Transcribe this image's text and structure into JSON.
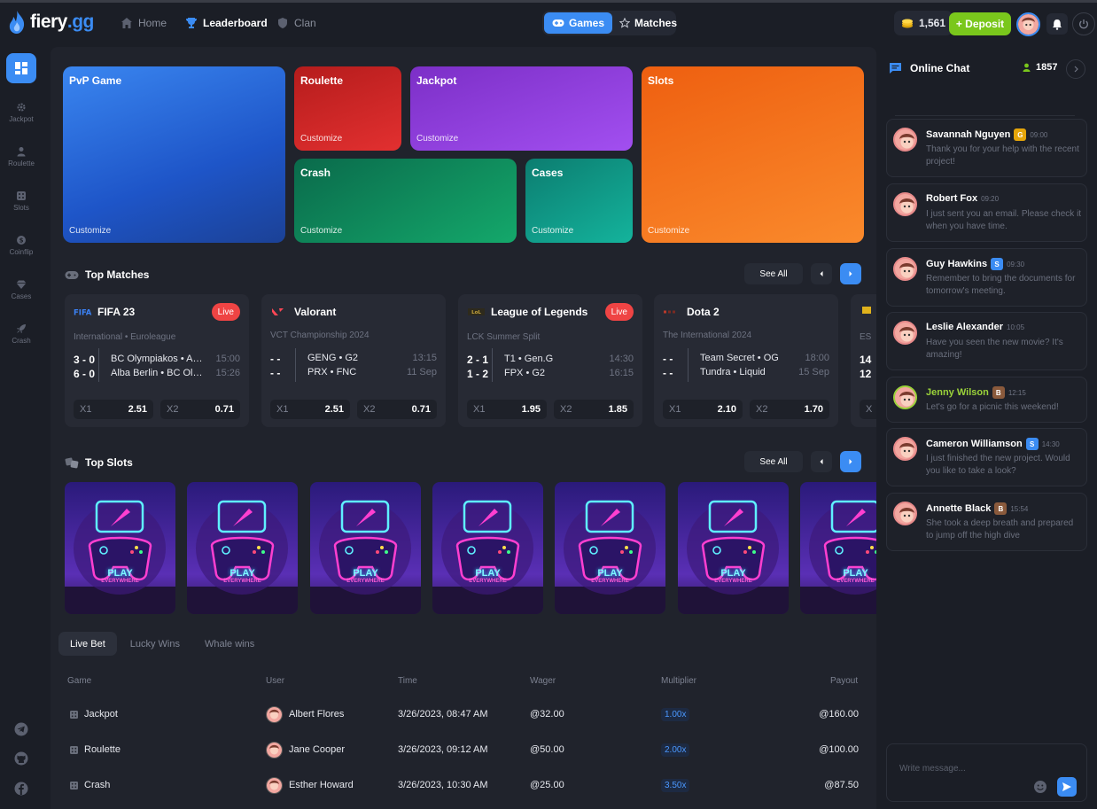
{
  "brand": {
    "name_main": "fiery",
    "name_suffix": ".gg"
  },
  "nav": [
    {
      "label": "Home",
      "icon": "home-icon"
    },
    {
      "label": "Leaderboard",
      "icon": "trophy-icon"
    },
    {
      "label": "Clan",
      "icon": "shield-icon"
    }
  ],
  "mode_switch": {
    "games": "Games",
    "matches": "Matches"
  },
  "header": {
    "balance": "1,561",
    "deposit": "+ Deposit"
  },
  "sidebar": [
    {
      "label": "Jackpot",
      "icon": "gear-icon"
    },
    {
      "label": "Roulette",
      "icon": "user-icon"
    },
    {
      "label": "Slots",
      "icon": "dice-icon"
    },
    {
      "label": "Coinflip",
      "icon": "coin-icon"
    },
    {
      "label": "Cases",
      "icon": "gem-icon"
    },
    {
      "label": "Crash",
      "icon": "rocket-icon"
    }
  ],
  "tiles": {
    "pvp": {
      "title": "PvP Game",
      "customize": "Customize"
    },
    "roulette": {
      "title": "Roulette",
      "customize": "Customize"
    },
    "jackpot": {
      "title": "Jackpot",
      "customize": "Customize"
    },
    "slots": {
      "title": "Slots",
      "customize": "Customize"
    },
    "crash": {
      "title": "Crash",
      "customize": "Customize"
    },
    "cases": {
      "title": "Cases",
      "customize": "Customize"
    }
  },
  "top_matches": {
    "title": "Top Matches",
    "see_all": "See All",
    "cards": [
      {
        "game": "FIFA 23",
        "live": "Live",
        "league": "International • Euroleague",
        "rows": [
          {
            "score": "3 - 0",
            "teams": "BC Olympiakos • A…",
            "time": "15:00"
          },
          {
            "score": "6 - 0",
            "teams": "Alba Berlin • BC Ol…",
            "time": "15:26"
          }
        ],
        "odds": [
          {
            "label": "X1",
            "value": "2.51"
          },
          {
            "label": "X2",
            "value": "0.71"
          }
        ]
      },
      {
        "game": "Valorant",
        "live": "",
        "league": "VCT Championship 2024",
        "rows": [
          {
            "score": "- -",
            "teams": "GENG • G2",
            "time": "13:15"
          },
          {
            "score": "- -",
            "teams": "PRX • FNC",
            "time": "11 Sep"
          }
        ],
        "odds": [
          {
            "label": "X1",
            "value": "2.51"
          },
          {
            "label": "X2",
            "value": "0.71"
          }
        ]
      },
      {
        "game": "League of Legends",
        "live": "Live",
        "league": "LCK Summer Split",
        "rows": [
          {
            "score": "2 - 1",
            "teams": "T1 • Gen.G",
            "time": "14:30"
          },
          {
            "score": "1 - 2",
            "teams": "FPX • G2",
            "time": "16:15"
          }
        ],
        "odds": [
          {
            "label": "X1",
            "value": "1.95"
          },
          {
            "label": "X2",
            "value": "1.85"
          }
        ]
      },
      {
        "game": "Dota 2",
        "live": "",
        "league": "The International 2024",
        "rows": [
          {
            "score": "- -",
            "teams": "Team Secret • OG",
            "time": "18:00"
          },
          {
            "score": "- -",
            "teams": "Tundra • Liquid",
            "time": "15 Sep"
          }
        ],
        "odds": [
          {
            "label": "X1",
            "value": "2.10"
          },
          {
            "label": "X2",
            "value": "1.70"
          }
        ]
      },
      {
        "game": "",
        "live": "",
        "league": "ES",
        "rows": [
          {
            "score": "14",
            "teams": "",
            "time": ""
          },
          {
            "score": "12",
            "teams": "",
            "time": ""
          }
        ],
        "odds": [
          {
            "label": "X",
            "value": ""
          },
          {
            "label": "",
            "value": ""
          }
        ]
      }
    ]
  },
  "top_slots": {
    "title": "Top Slots",
    "see_all": "See All",
    "slots": [
      {
        "play": "PLAY",
        "sub": "EVERYWHERE"
      },
      {
        "play": "PLAY",
        "sub": "EVERYWHERE"
      },
      {
        "play": "PLAY",
        "sub": "EVERYWHERE"
      },
      {
        "play": "PLAY",
        "sub": "EVERYWHERE"
      },
      {
        "play": "PLAY",
        "sub": "EVERYWHERE"
      },
      {
        "play": "PLAY",
        "sub": "EVERYWHERE"
      },
      {
        "play": "PLAY",
        "sub": "EVERYWHERE"
      }
    ]
  },
  "bets": {
    "tabs": [
      "Live Bet",
      "Lucky Wins",
      "Whale wins"
    ],
    "columns": [
      "Game",
      "User",
      "Time",
      "Wager",
      "Multiplier",
      "Payout"
    ],
    "rows": [
      {
        "game": "Jackpot",
        "user": "Albert Flores",
        "time": "3/26/2023, 08:47 AM",
        "wager": "@32.00",
        "multiplier": "1.00x",
        "payout": "@160.00"
      },
      {
        "game": "Roulette",
        "user": "Jane Cooper",
        "time": "3/26/2023, 09:12 AM",
        "wager": "@50.00",
        "multiplier": "2.00x",
        "payout": "@100.00"
      },
      {
        "game": "Crash",
        "user": "Esther Howard",
        "time": "3/26/2023, 10:30 AM",
        "wager": "@25.00",
        "multiplier": "3.50x",
        "payout": "@87.50"
      }
    ]
  },
  "chat": {
    "title": "Online Chat",
    "online_count": "1857",
    "placeholder": "Write message...",
    "messages": [
      {
        "name": "Savannah Nguyen",
        "badge": "G",
        "badge_color": "#e5a50a",
        "time": "09:00",
        "text": "Thank you for your help with the recent project!",
        "name_color": "#ffffff"
      },
      {
        "name": "Robert Fox",
        "badge": "",
        "badge_color": "",
        "time": "09:20",
        "text": "I just sent you an email. Please check it when you have time.",
        "name_color": "#ffffff"
      },
      {
        "name": "Guy Hawkins",
        "badge": "S",
        "badge_color": "#3b8cf3",
        "time": "09:30",
        "text": "Remember to bring the documents for tomorrow's meeting.",
        "name_color": "#ffffff"
      },
      {
        "name": "Leslie Alexander",
        "badge": "",
        "badge_color": "",
        "time": "10:05",
        "text": "Have you seen the new movie? It's amazing!",
        "name_color": "#ffffff"
      },
      {
        "name": "Jenny Wilson",
        "badge": "B",
        "badge_color": "#8a5a3c",
        "time": "12:15",
        "text": "Let's go for a picnic this weekend!",
        "name_color": "#9bd33a"
      },
      {
        "name": "Cameron Williamson",
        "badge": "S",
        "badge_color": "#3b8cf3",
        "time": "14:30",
        "text": "I just finished the new project. Would you like to take a look?",
        "name_color": "#ffffff"
      },
      {
        "name": "Annette Black",
        "badge": "B",
        "badge_color": "#8a5a3c",
        "time": "15:54",
        "text": "She took a deep breath and prepared to jump off the high dive",
        "name_color": "#ffffff"
      }
    ]
  },
  "colors": {
    "accent": "#3b8cf3",
    "deposit": "#7ac71c",
    "live": "#ef4444"
  }
}
